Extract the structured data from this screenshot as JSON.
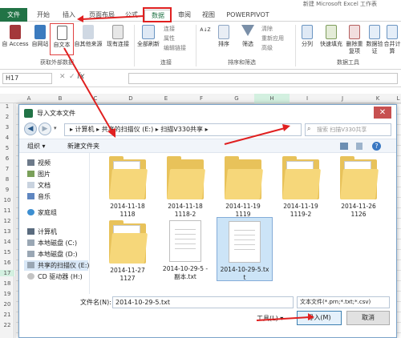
{
  "window": {
    "title": "新建 Microsoft Excel 工作表"
  },
  "tabs": [
    {
      "label": "文件"
    },
    {
      "label": "开始"
    },
    {
      "label": "插入"
    },
    {
      "label": "页面布局"
    },
    {
      "label": "公式"
    },
    {
      "label": "数据"
    },
    {
      "label": "审阅"
    },
    {
      "label": "视图"
    },
    {
      "label": "POWERPIVOT"
    }
  ],
  "ribbon": {
    "access": "自 Access",
    "web": "自网站",
    "text": "自文本",
    "other": "自其他来源",
    "existing": "现有连接",
    "refresh_all": "全部刷新",
    "connections": "连接",
    "properties": "属性",
    "edit_links": "编辑链接",
    "sort_az": "A↓Z",
    "sort": "排序",
    "filter": "筛选",
    "clear": "清除",
    "reapply": "重新应用",
    "advanced": "高级",
    "split": "分列",
    "flash_fill": "快速填充",
    "remove_dup": "删除重复项",
    "validation": "数据验证",
    "consolidate": "合并计算",
    "group_external": "获取外部数据",
    "group_connections": "连接",
    "group_sort": "排序和筛选",
    "group_tools": "数据工具"
  },
  "formula_bar": {
    "cell": "H17",
    "fx": "fx",
    "cancel": "✕",
    "enter": "✓"
  },
  "sheet": {
    "columns": [
      "A",
      "B",
      "C",
      "D",
      "E",
      "F",
      "G",
      "H",
      "I",
      "J",
      "K",
      "L"
    ],
    "rows": [
      "1",
      "2",
      "3",
      "4",
      "5",
      "6",
      "7",
      "8",
      "9",
      "10",
      "11",
      "12",
      "13",
      "14",
      "15",
      "16",
      "17",
      "18",
      "19",
      "20",
      "21",
      "22"
    ]
  },
  "dialog": {
    "title": "导入文本文件",
    "close": "✕",
    "path": "▸ 计算机 ▸ 共享的扫描仪 (E:) ▸ 扫描V330共享 ▸",
    "search_placeholder": "搜索 扫描V330共享",
    "organize": "组织 ▾",
    "new_folder": "新建文件夹",
    "nav": [
      {
        "label": "视频"
      },
      {
        "label": "图片"
      },
      {
        "label": "文档"
      },
      {
        "label": "音乐"
      },
      {
        "label": "家庭组"
      },
      {
        "label": "计算机"
      },
      {
        "label": "本地磁盘 (C:)"
      },
      {
        "label": "本地磁盘 (D:)"
      },
      {
        "label": "共享的扫描仪 (E:)"
      },
      {
        "label": "CD 驱动器 (H:)"
      }
    ],
    "files": [
      {
        "line1": "2014-11-18",
        "line2": "1118",
        "kind": "folder"
      },
      {
        "line1": "2014-11-18",
        "line2": "1118-2",
        "kind": "folder"
      },
      {
        "line1": "2014-11-19",
        "line2": "1119",
        "kind": "folder"
      },
      {
        "line1": "2014-11-19",
        "line2": "1119-2",
        "kind": "folder"
      },
      {
        "line1": "2014-11-26",
        "line2": "1126",
        "kind": "folder"
      },
      {
        "line1": "2014-11-27",
        "line2": "1127",
        "kind": "folder"
      },
      {
        "line1": "2014-10-29-5 -",
        "line2": "副本.txt",
        "kind": "txt"
      },
      {
        "line1": "2014-10-29-5.tx",
        "line2": "t",
        "kind": "txt"
      }
    ],
    "filename_label": "文件名(N):",
    "filename_value": "2014-10-29-5.txt",
    "filetype": "文本文件(*.prn;*.txt;*.csv)",
    "tools": "工具(L) ▾",
    "import": "导入(M)",
    "cancel": "取消"
  },
  "colors": {
    "excel_green": "#217346",
    "folder": "#e8c25a",
    "selection": "#cce4f7",
    "annotation_red": "#e02020"
  }
}
